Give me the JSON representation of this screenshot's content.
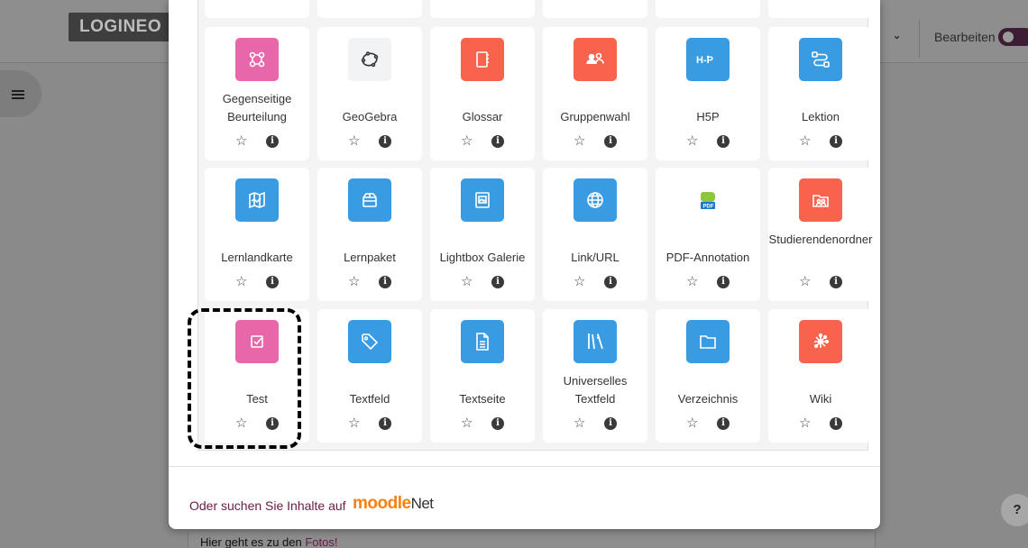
{
  "background": {
    "logo_text": "LOGINEO",
    "edit_label": "Bearbeiten",
    "help_label": "?",
    "bottom_text_prefix": "Hier geht es zu den ",
    "bottom_text_link": "Fotos!"
  },
  "modules": [
    {
      "label": "Gegenseitige Beurteilung",
      "icon": "peer-review-icon",
      "color": "#e866aa"
    },
    {
      "label": "GeoGebra",
      "icon": "geogebra-icon",
      "color": "#f2f3f5"
    },
    {
      "label": "Glossar",
      "icon": "glossary-book-icon",
      "color": "#f7634d"
    },
    {
      "label": "Gruppenwahl",
      "icon": "group-choice-icon",
      "color": "#f7634d"
    },
    {
      "label": "H5P",
      "icon": "h5p-icon",
      "color": "#399be2"
    },
    {
      "label": "Lektion",
      "icon": "lesson-path-icon",
      "color": "#399be2"
    },
    {
      "label": "Lernlandkarte",
      "icon": "learning-map-icon",
      "color": "#399be2"
    },
    {
      "label": "Lernpaket",
      "icon": "package-icon",
      "color": "#399be2"
    },
    {
      "label": "Lightbox Galerie",
      "icon": "gallery-image-icon",
      "color": "#399be2"
    },
    {
      "label": "Link/URL",
      "icon": "globe-icon",
      "color": "#399be2"
    },
    {
      "label": "PDF-Annotation",
      "icon": "pdf-annotation-icon",
      "color": "#ffffff"
    },
    {
      "label": "Studierendenordner",
      "icon": "student-folder-icon",
      "color": "#f7634d"
    },
    {
      "label": "Test",
      "icon": "quiz-checkbox-icon",
      "color": "#e866aa"
    },
    {
      "label": "Textfeld",
      "icon": "tag-icon",
      "color": "#399be2"
    },
    {
      "label": "Textseite",
      "icon": "page-icon",
      "color": "#399be2"
    },
    {
      "label": "Universelles Textfeld",
      "icon": "tools-icon",
      "color": "#399be2"
    },
    {
      "label": "Verzeichnis",
      "icon": "folder-icon",
      "color": "#399be2"
    },
    {
      "label": "Wiki",
      "icon": "wiki-network-icon",
      "color": "#f7634d"
    }
  ],
  "footer": {
    "search_text": "Oder suchen Sie Inhalte auf ",
    "moodlenet_brand_a": "moodle",
    "moodlenet_brand_b": "Net"
  }
}
